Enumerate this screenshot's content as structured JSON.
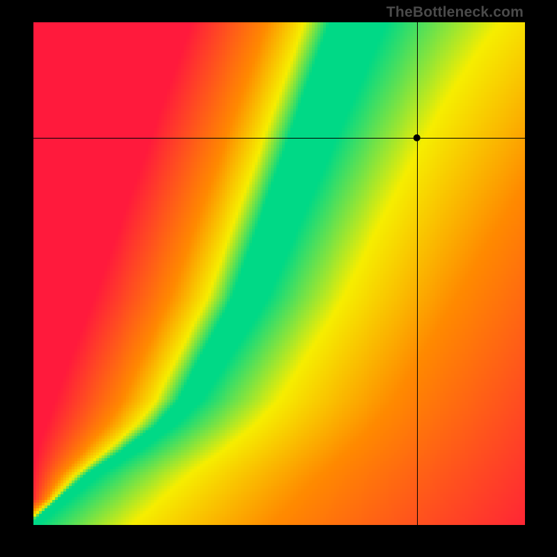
{
  "watermark_text": "TheBottleneck.com",
  "chart_data": {
    "type": "heatmap",
    "title": "",
    "xlabel": "",
    "ylabel": "",
    "xlim": [
      0,
      100
    ],
    "ylim": [
      0,
      100
    ],
    "grid_resolution": 180,
    "crosshair": {
      "x_frac": 0.78,
      "y_frac": 0.77
    },
    "marker": {
      "x_frac": 0.78,
      "y_frac": 0.77
    },
    "ridge": {
      "description": "Green optimal band; x_frac as function of y_frac",
      "control_points": [
        {
          "y_frac": 0.0,
          "x_frac": 0.0,
          "width_frac": 0.01
        },
        {
          "y_frac": 0.05,
          "x_frac": 0.06,
          "width_frac": 0.012
        },
        {
          "y_frac": 0.1,
          "x_frac": 0.12,
          "width_frac": 0.015
        },
        {
          "y_frac": 0.15,
          "x_frac": 0.2,
          "width_frac": 0.018
        },
        {
          "y_frac": 0.2,
          "x_frac": 0.27,
          "width_frac": 0.02
        },
        {
          "y_frac": 0.25,
          "x_frac": 0.32,
          "width_frac": 0.024
        },
        {
          "y_frac": 0.3,
          "x_frac": 0.35,
          "width_frac": 0.028
        },
        {
          "y_frac": 0.35,
          "x_frac": 0.38,
          "width_frac": 0.031
        },
        {
          "y_frac": 0.4,
          "x_frac": 0.41,
          "width_frac": 0.034
        },
        {
          "y_frac": 0.45,
          "x_frac": 0.44,
          "width_frac": 0.036
        },
        {
          "y_frac": 0.5,
          "x_frac": 0.46,
          "width_frac": 0.038
        },
        {
          "y_frac": 0.55,
          "x_frac": 0.48,
          "width_frac": 0.04
        },
        {
          "y_frac": 0.6,
          "x_frac": 0.5,
          "width_frac": 0.042
        },
        {
          "y_frac": 0.65,
          "x_frac": 0.52,
          "width_frac": 0.044
        },
        {
          "y_frac": 0.7,
          "x_frac": 0.54,
          "width_frac": 0.046
        },
        {
          "y_frac": 0.75,
          "x_frac": 0.56,
          "width_frac": 0.048
        },
        {
          "y_frac": 0.8,
          "x_frac": 0.58,
          "width_frac": 0.05
        },
        {
          "y_frac": 0.85,
          "x_frac": 0.6,
          "width_frac": 0.052
        },
        {
          "y_frac": 0.9,
          "x_frac": 0.62,
          "width_frac": 0.054
        },
        {
          "y_frac": 0.95,
          "x_frac": 0.64,
          "width_frac": 0.056
        },
        {
          "y_frac": 1.0,
          "x_frac": 0.66,
          "width_frac": 0.058
        }
      ]
    },
    "colors": {
      "green": "#00d986",
      "yellow": "#f6ee00",
      "orange": "#ff8a00",
      "red": "#ff1a3c"
    }
  }
}
